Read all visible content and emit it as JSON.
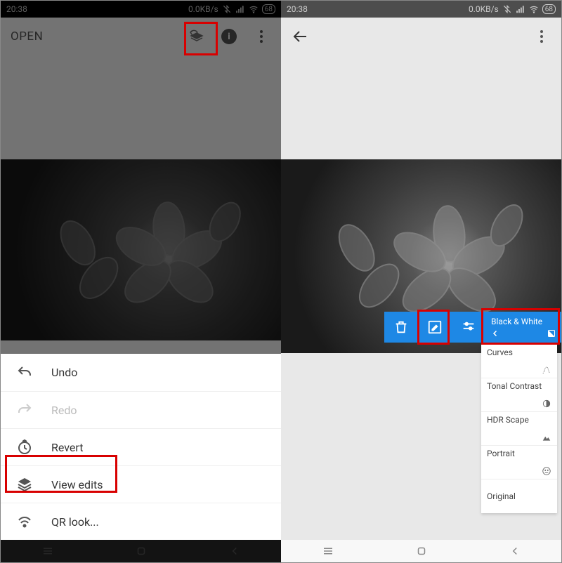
{
  "status": {
    "time": "20:38",
    "data_rate": "0.0KB/s",
    "battery": "68"
  },
  "left": {
    "open_label": "OPEN",
    "menu": {
      "undo": "Undo",
      "redo": "Redo",
      "revert": "Revert",
      "view_edits": "View edits",
      "qr_look": "QR look..."
    }
  },
  "right": {
    "current_filter": "Black & White",
    "stack": {
      "curves": "Curves",
      "tonal": "Tonal Contrast",
      "hdr": "HDR Scape",
      "portrait": "Portrait",
      "original": "Original"
    }
  }
}
